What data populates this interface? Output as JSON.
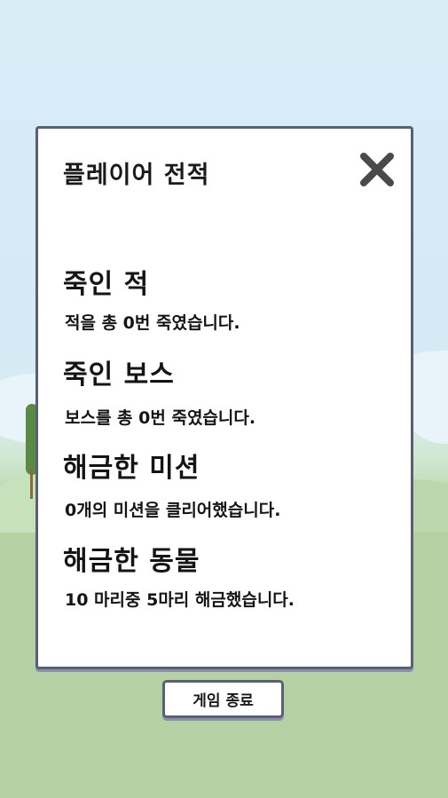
{
  "panel": {
    "title": "플레이어 전적",
    "close_icon": "close-x-icon",
    "stats": [
      {
        "title": "죽인 적",
        "description": "적을 총 0번 죽였습니다."
      },
      {
        "title": "죽인 보스",
        "description": "보스를 총 0번 죽였습니다."
      },
      {
        "title": "해금한 미션",
        "description": "0개의 미션을 클리어했습니다."
      },
      {
        "title": "해금한 동물",
        "description": "10 마리중 5마리 해금했습니다."
      }
    ]
  },
  "footer": {
    "exit_label": "게임 종료"
  },
  "colors": {
    "panel_border": "#5a5f78",
    "sky": "#d4eaf5",
    "grass": "#b6d1a2",
    "close_icon": "#4a4a4a"
  }
}
